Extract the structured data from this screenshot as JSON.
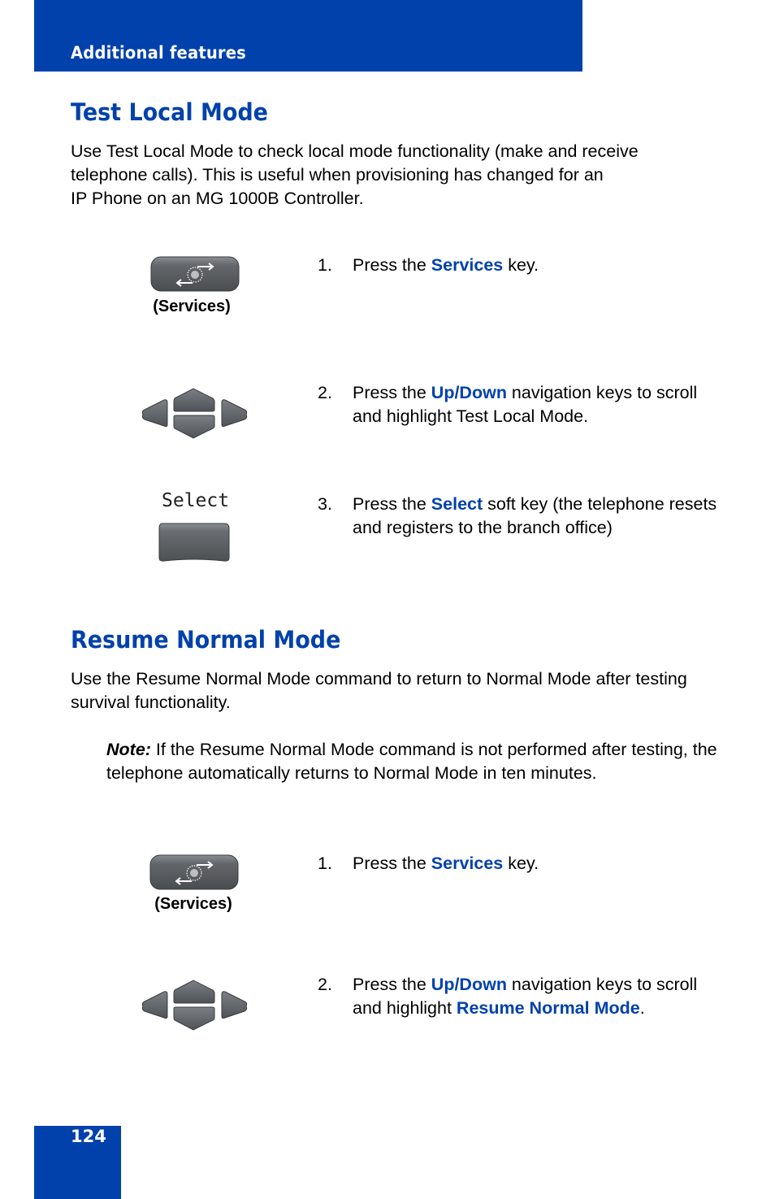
{
  "header": {
    "title": "Additional features"
  },
  "sections": [
    {
      "title": "Test Local Mode",
      "intro": "Use Test Local Mode to check local mode functionality (make and receive telephone calls). This is useful when provisioning has changed for an IP Phone on an MG 1000B Controller.",
      "intro_lines": [
        "Use Test Local Mode to check local mode functionality (make and receive",
        "telephone calls). This is useful when provisioning has changed for an",
        "IP Phone on an MG 1000B Controller."
      ],
      "steps": [
        {
          "num": "1.",
          "icon": "services-key-icon",
          "icon_caption": "(Services)",
          "pre": "Press the ",
          "hl": "Services",
          "post": " key."
        },
        {
          "num": "2.",
          "icon": "navigation-keys-icon",
          "pre": "Press the ",
          "hl": "Up/Down",
          "post": " navigation keys to scroll and highlight Test Local Mode."
        },
        {
          "num": "3.",
          "icon": "select-soft-key-icon",
          "icon_label": "Select",
          "pre": "Press the ",
          "hl": "Select",
          "post": " soft key (the telephone resets and registers to the branch office)"
        }
      ]
    },
    {
      "title": "Resume Normal Mode",
      "intro": "Use the Resume Normal Mode command to return to Normal Mode after testing survival functionality.",
      "note_label": "Note:",
      "note_text": " If the Resume Normal Mode command is not performed after testing, the telephone automatically returns to Normal Mode in ten minutes.",
      "steps": [
        {
          "num": "1.",
          "icon": "services-key-icon",
          "icon_caption": "(Services)",
          "pre": "Press the ",
          "hl": "Services",
          "post": " key."
        },
        {
          "num": "2.",
          "icon": "navigation-keys-icon",
          "pre": "Press the ",
          "hl": "Up/Down",
          "post": " navigation keys to scroll and highlight ",
          "hl2": "Resume Normal Mode",
          "post2": "."
        }
      ]
    }
  ],
  "footer": {
    "page_number": "124"
  },
  "colors": {
    "brand_blue": "#0041ab",
    "key_gray": "#5e6266"
  }
}
